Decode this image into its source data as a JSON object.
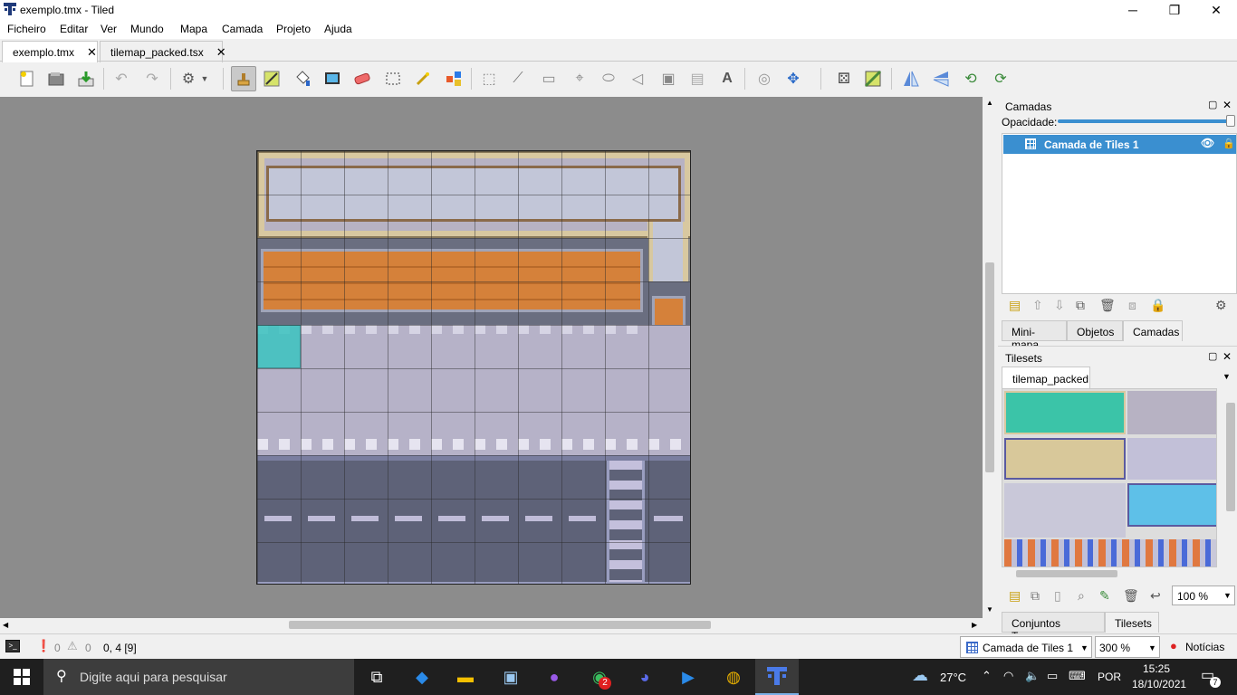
{
  "window": {
    "title": "exemplo.tmx - Tiled",
    "minimize": "─",
    "maximize": "❐",
    "close": "✕"
  },
  "menu": [
    "Ficheiro",
    "Editar",
    "Ver",
    "Mundo",
    "Mapa",
    "Camada",
    "Projeto",
    "Ajuda"
  ],
  "tabs": [
    {
      "label": "exemplo.tmx",
      "close": "✕"
    },
    {
      "label": "tilemap_packed.tsx",
      "close": "✕"
    }
  ],
  "layers_panel": {
    "title": "Camadas",
    "opacity_label": "Opacidade:",
    "opacity": 1.0,
    "layers": [
      {
        "name": "Camada de Tiles 1",
        "visible_icon": "👁"
      }
    ],
    "tabs": [
      "Mini-mapa",
      "Objetos",
      "Camadas"
    ],
    "selected_tab": "Camadas"
  },
  "tilesets_panel": {
    "title": "Tilesets",
    "tileset_tab": "tilemap_packed",
    "zoom": "100 %",
    "tabs": [
      "Conjuntos Terreno",
      "Tilesets"
    ],
    "selected_tab": "Tilesets"
  },
  "status": {
    "errors": "0",
    "warnings": "0",
    "coords": "0, 4 [9]",
    "layer": "Camada de Tiles 1",
    "zoom": "300 %",
    "news": "Notícias"
  },
  "taskbar": {
    "search_placeholder": "Digite aqui para pesquisar",
    "weather": "27°C",
    "lang": "POR",
    "time": "15:25",
    "date": "18/10/2021",
    "whatsapp_badge": "2",
    "notif_count": "7"
  }
}
